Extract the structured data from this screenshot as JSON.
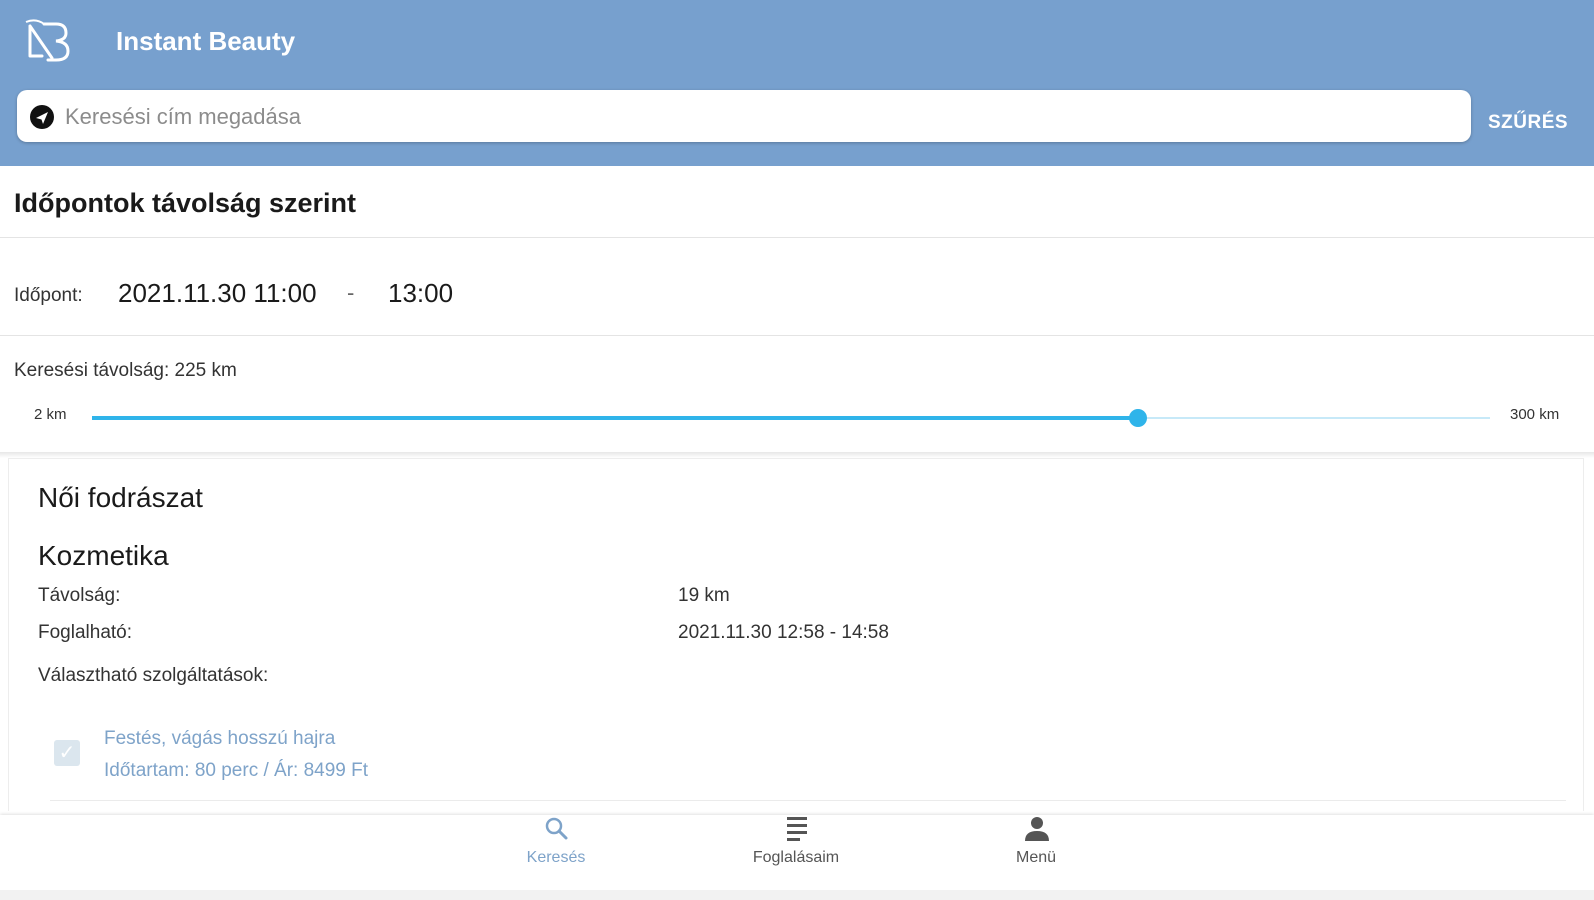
{
  "app": {
    "title": "Instant Beauty"
  },
  "search": {
    "placeholder": "Keresési cím megadása",
    "value": ""
  },
  "filter": {
    "label": "SZŰRÉS"
  },
  "section": {
    "title": "Időpontok  távolság szerint"
  },
  "time": {
    "label": "Időpont:",
    "start": "2021.11.30 11:00",
    "separator": "-",
    "end": "13:00"
  },
  "distance": {
    "text": "Keresési távolság: 225 km",
    "value_km": 225,
    "min_km": 2,
    "max_km": 300,
    "min_label": "2 km",
    "max_label": "300 km"
  },
  "result": {
    "salon": "Női fodrászat",
    "category": "Kozmetika",
    "distance_label": "Távolság:",
    "distance_value": "19 km",
    "available_label": "Foglalható:",
    "available_value": "2021.11.30 12:58 - 14:58",
    "services_label": "Választható szolgáltatások:",
    "services": [
      {
        "name": "Festés, vágás hosszú hajra",
        "detail": "Időtartam: 80 perc / Ár: 8499 Ft",
        "checked": true
      }
    ]
  },
  "nav": {
    "items": [
      {
        "label": "Keresés",
        "icon": "search-icon",
        "active": true
      },
      {
        "label": "Foglalásaim",
        "icon": "list-icon",
        "active": false
      },
      {
        "label": "Menü",
        "icon": "person-icon",
        "active": false
      }
    ]
  },
  "colors": {
    "header": "#77a0ce",
    "accent": "#2fb4ea",
    "active_nav": "#7ea3c9",
    "inactive_nav": "#555555"
  }
}
